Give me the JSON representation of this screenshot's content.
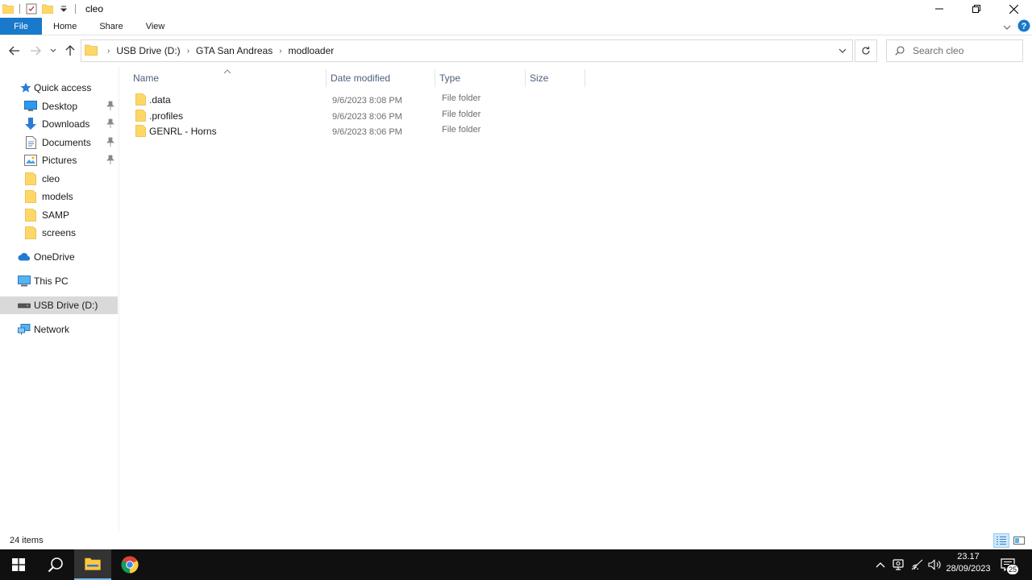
{
  "window": {
    "title": "cleo"
  },
  "ribbon": {
    "tabs": [
      "File",
      "Home",
      "Share",
      "View"
    ]
  },
  "address": {
    "crumbs": [
      "USB Drive (D:)",
      "GTA San Andreas",
      "modloader"
    ]
  },
  "search": {
    "placeholder": "Search cleo"
  },
  "nav": {
    "quick_access": "Quick access",
    "items": [
      "Desktop",
      "Downloads",
      "Documents",
      "Pictures",
      "cleo",
      "models",
      "SAMP",
      "screens"
    ],
    "onedrive": "OneDrive",
    "this_pc": "This PC",
    "usb_drive": "USB Drive (D:)",
    "network": "Network"
  },
  "columns": {
    "name": "Name",
    "date": "Date modified",
    "type": "Type",
    "size": "Size"
  },
  "files": [
    {
      "name": ".data",
      "date": "9/6/2023 8:08 PM",
      "type": "File folder"
    },
    {
      "name": ".profiles",
      "date": "9/6/2023 8:06 PM",
      "type": "File folder"
    },
    {
      "name": "GENRL - Horns",
      "date": "9/6/2023 8:06 PM",
      "type": "File folder"
    }
  ],
  "status": {
    "item_count": "24 items"
  },
  "taskbar": {
    "time": "23.17",
    "date": "28/09/2023",
    "notifications": "25"
  },
  "colors": {
    "file_tab": "#1979ca",
    "folder_yellow": "#ffd766",
    "folder_dark": "#e6b94a",
    "selection": "#d9d9d9",
    "taskbar": "#101010",
    "header_text": "#4c607a"
  }
}
